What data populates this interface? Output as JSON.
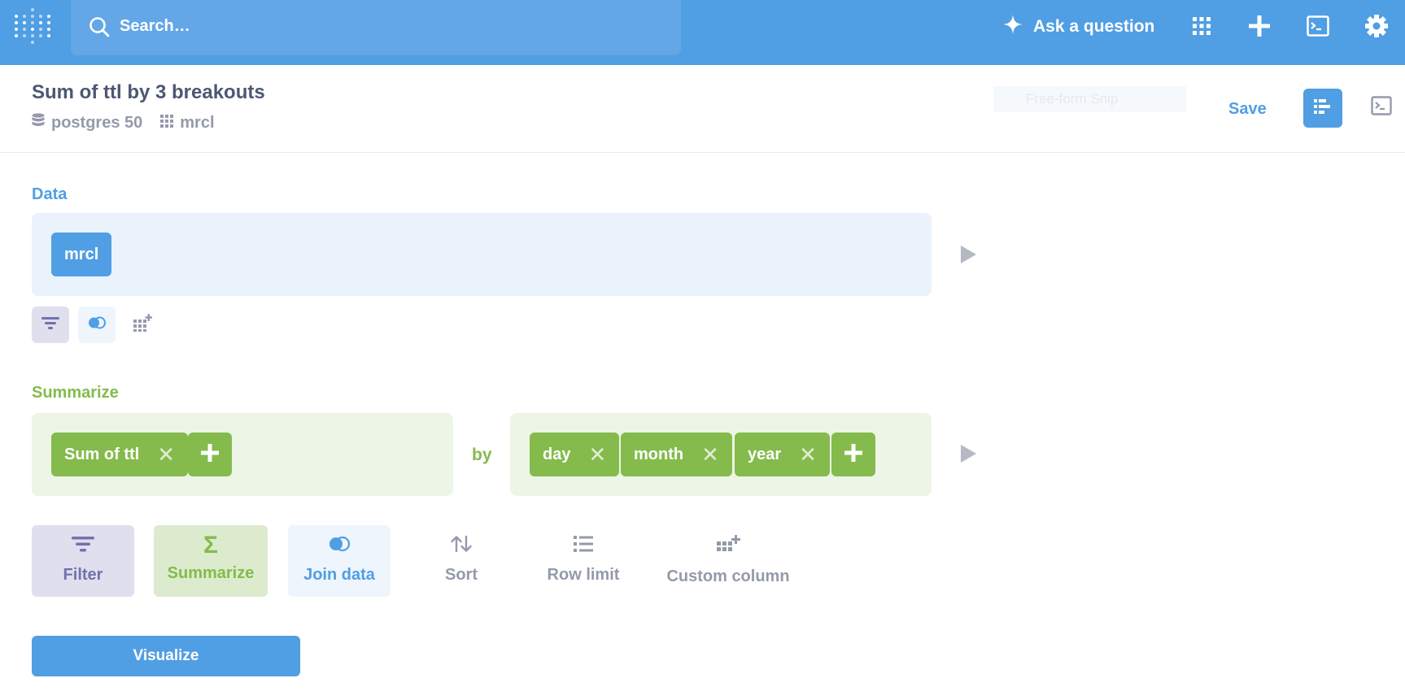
{
  "nav": {
    "search_placeholder": "Search…",
    "ask_label": "Ask a question"
  },
  "header": {
    "title": "Sum of ttl by 3 breakouts",
    "database": "postgres 50",
    "table": "mrcl",
    "snip_label": "Free-form Snip",
    "save_label": "Save"
  },
  "data_section": {
    "label": "Data",
    "source": "mrcl"
  },
  "summarize_section": {
    "label": "Summarize",
    "metric": "Sum of ttl",
    "by_label": "by",
    "breakouts": [
      "day",
      "month",
      "year"
    ]
  },
  "actions": {
    "filter": "Filter",
    "summarize": "Summarize",
    "join": "Join data",
    "sort": "Sort",
    "row_limit": "Row limit",
    "custom_column": "Custom column"
  },
  "visualize_label": "Visualize",
  "colors": {
    "brand": "#509ee3",
    "summarize": "#84bb4c",
    "filter": "#7172ad"
  }
}
